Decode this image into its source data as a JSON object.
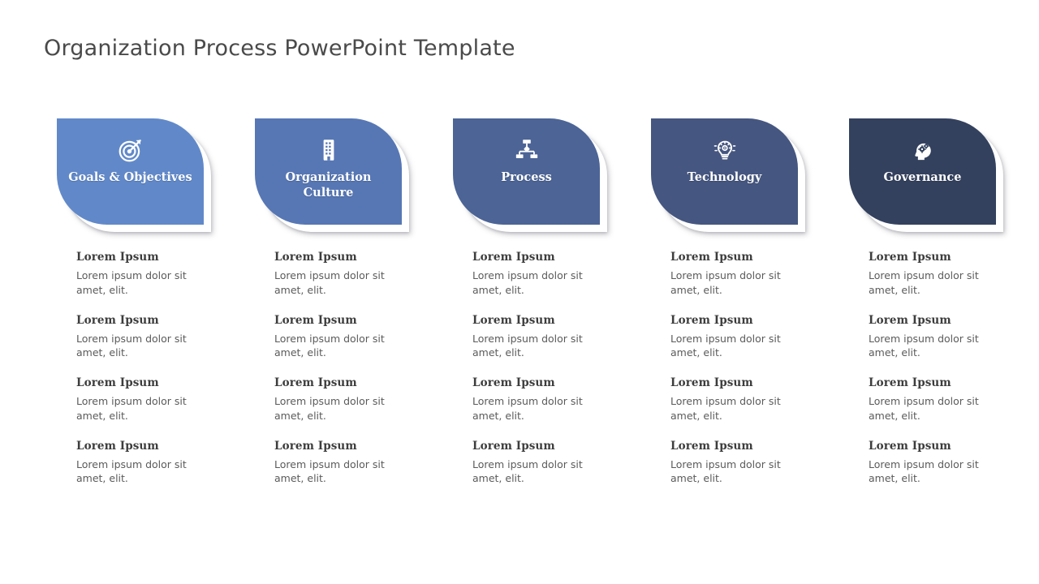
{
  "slide": {
    "title": "Organization Process PowerPoint Template",
    "title_color": "#4a4a4a",
    "background_color": "#ffffff"
  },
  "columns": [
    {
      "card": {
        "label": "Goals & Objectives",
        "icon": "target-arrow-icon",
        "color": "#6189c9"
      },
      "bullets": [
        {
          "heading": "Lorem Ipsum",
          "body": "Lorem ipsum dolor sit amet, elit."
        },
        {
          "heading": "Lorem Ipsum",
          "body": "Lorem ipsum dolor sit amet, elit."
        },
        {
          "heading": "Lorem Ipsum",
          "body": "Lorem ipsum dolor sit amet, elit."
        },
        {
          "heading": "Lorem Ipsum",
          "body": "Lorem ipsum dolor sit amet, elit."
        }
      ]
    },
    {
      "card": {
        "label": "Organization Culture",
        "icon": "office-building-icon",
        "color": "#5777b4"
      },
      "bullets": [
        {
          "heading": "Lorem Ipsum",
          "body": "Lorem ipsum dolor sit amet, elit."
        },
        {
          "heading": "Lorem Ipsum",
          "body": "Lorem ipsum dolor sit amet, elit."
        },
        {
          "heading": "Lorem Ipsum",
          "body": "Lorem ipsum dolor sit amet, elit."
        },
        {
          "heading": "Lorem Ipsum",
          "body": "Lorem ipsum dolor sit amet, elit."
        }
      ]
    },
    {
      "card": {
        "label": "Process",
        "icon": "org-chart-hierarchy-icon",
        "color": "#4c6496"
      },
      "bullets": [
        {
          "heading": "Lorem Ipsum",
          "body": "Lorem ipsum dolor sit amet, elit."
        },
        {
          "heading": "Lorem Ipsum",
          "body": "Lorem ipsum dolor sit amet, elit."
        },
        {
          "heading": "Lorem Ipsum",
          "body": "Lorem ipsum dolor sit amet, elit."
        },
        {
          "heading": "Lorem Ipsum",
          "body": "Lorem ipsum dolor sit amet, elit."
        }
      ]
    },
    {
      "card": {
        "label": "Technology",
        "icon": "lightbulb-gear-icon",
        "color": "#455680"
      },
      "bullets": [
        {
          "heading": "Lorem Ipsum",
          "body": "Lorem ipsum dolor sit amet, elit."
        },
        {
          "heading": "Lorem Ipsum",
          "body": "Lorem ipsum dolor sit amet, elit."
        },
        {
          "heading": "Lorem Ipsum",
          "body": "Lorem ipsum dolor sit amet, elit."
        },
        {
          "heading": "Lorem Ipsum",
          "body": "Lorem ipsum dolor sit amet, elit."
        }
      ]
    },
    {
      "card": {
        "label": "Governance",
        "icon": "head-gears-icon",
        "color": "#33415e"
      },
      "bullets": [
        {
          "heading": "Lorem Ipsum",
          "body": "Lorem ipsum dolor sit amet, elit."
        },
        {
          "heading": "Lorem Ipsum",
          "body": "Lorem ipsum dolor sit amet, elit."
        },
        {
          "heading": "Lorem Ipsum",
          "body": "Lorem ipsum dolor sit amet, elit."
        },
        {
          "heading": "Lorem Ipsum",
          "body": "Lorem ipsum dolor sit amet, elit."
        }
      ]
    }
  ]
}
